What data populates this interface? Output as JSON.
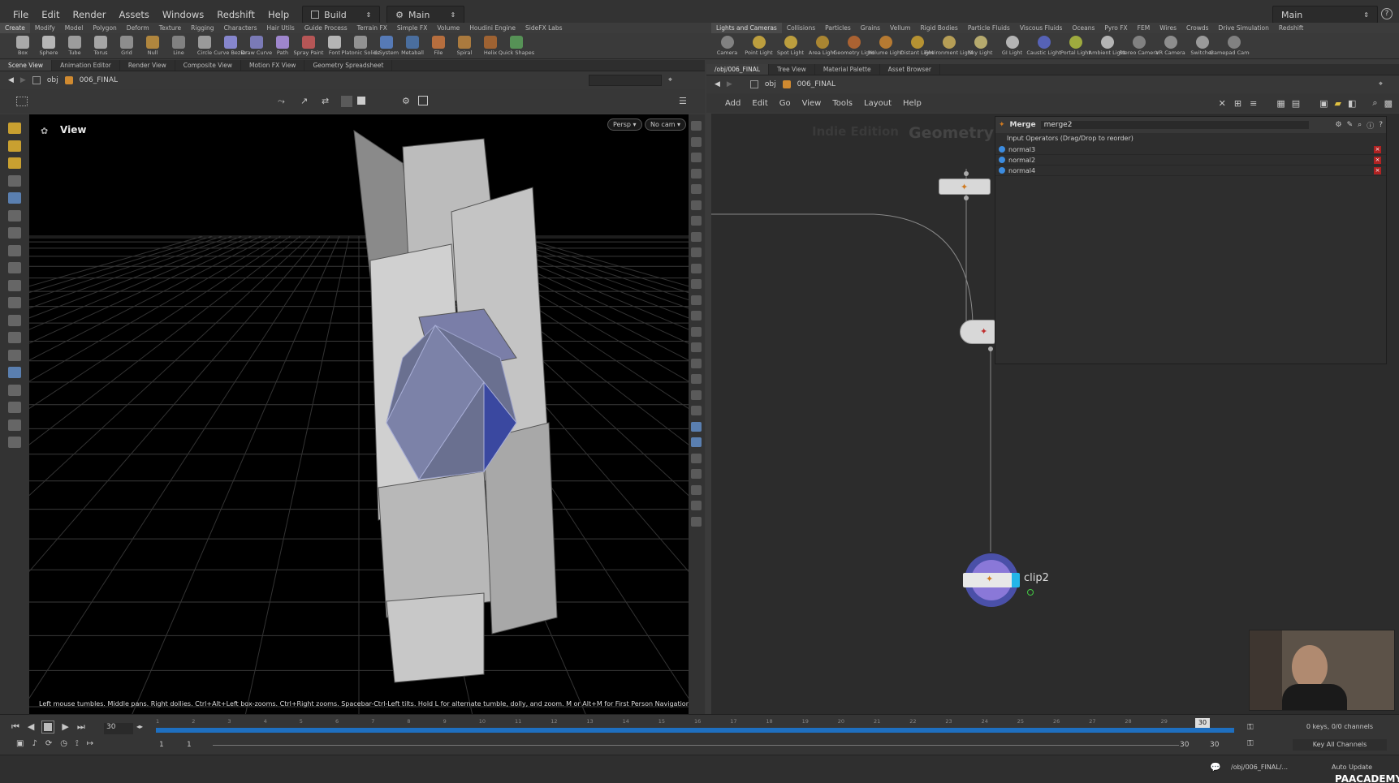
{
  "menu": {
    "items": [
      "File",
      "Edit",
      "Render",
      "Assets",
      "Windows",
      "Redshift",
      "Help"
    ],
    "desktop_left": "Build",
    "desktop_middle": "Main",
    "desktop_right": "Main"
  },
  "shelf_tabs_left": [
    "Create",
    "Modify",
    "Model",
    "Polygon",
    "Deform",
    "Texture",
    "Rigging",
    "Characters",
    "Hair Utils",
    "Guide Process",
    "Terrain FX",
    "Simple FX",
    "Volume",
    "Houdini Engine",
    "SideFX Labs"
  ],
  "shelf_tools_left": [
    "Box",
    "Sphere",
    "Tube",
    "Torus",
    "Grid",
    "Null",
    "Line",
    "Circle",
    "Curve Bezier",
    "Draw Curve",
    "Path",
    "Spray Paint",
    "Font",
    "Platonic Solids",
    "L-System",
    "Metaball",
    "File",
    "Spiral",
    "Helix",
    "Quick Shapes"
  ],
  "shelf_tabs_right": [
    "Lights and Cameras",
    "Collisions",
    "Particles",
    "Grains",
    "Vellum",
    "Rigid Bodies",
    "Particle Fluids",
    "Viscous Fluids",
    "Oceans",
    "Pyro FX",
    "FEM",
    "Wires",
    "Crowds",
    "Drive Simulation",
    "Redshift"
  ],
  "shelf_tools_right": [
    "Camera",
    "Point Light",
    "Spot Light",
    "Area Light",
    "Geometry Light",
    "Volume Light",
    "Distant Light",
    "Environment Light",
    "Sky Light",
    "GI Light",
    "Caustic Light",
    "Portal Light",
    "Ambient Light",
    "Stereo Camera",
    "VR Camera",
    "Switcher",
    "Gamepad Camera"
  ],
  "left_pane": {
    "tabs": [
      "Scene View",
      "Animation Editor",
      "Render View",
      "Composite View",
      "Motion FX View",
      "Geometry Spreadsheet"
    ],
    "path_root": "obj",
    "path_node": "006_FINAL",
    "view_label": "View",
    "persp": "Persp",
    "cam": "No cam",
    "hint": "Left mouse tumbles. Middle pans. Right dollies. Ctrl+Alt+Left box-zooms. Ctrl+Right zooms. Spacebar-Ctrl-Left tilts. Hold L for alternate tumble, dolly, and zoom. M or Alt+M for First Person Navigation."
  },
  "right_pane": {
    "tabs": [
      "/obj/006_FINAL",
      "Tree View",
      "Material Palette",
      "Asset Browser"
    ],
    "path_root": "obj",
    "path_node": "006_FINAL",
    "menu": [
      "Add",
      "Edit",
      "Go",
      "View",
      "Tools",
      "Layout",
      "Help"
    ],
    "watermark_edition": "Indie Edition",
    "watermark_context": "Geometry",
    "node_label": "clip2"
  },
  "params": {
    "type": "Merge",
    "name": "merge2",
    "section": "Input Operators (Drag/Drop to reorder)",
    "inputs": [
      "normal3",
      "normal2",
      "normal4"
    ]
  },
  "timeline": {
    "current_frame": "30",
    "ticks": [
      "1",
      "2",
      "3",
      "4",
      "5",
      "6",
      "7",
      "8",
      "9",
      "10",
      "11",
      "12",
      "13",
      "14",
      "15",
      "16",
      "17",
      "18",
      "19",
      "20",
      "21",
      "22",
      "23",
      "24",
      "25",
      "26",
      "27",
      "28",
      "29",
      "30"
    ],
    "start_a": "1",
    "start_b": "1",
    "end_a": "30",
    "end_b": "30",
    "keys_info": "0 keys, 0/0 channels",
    "key_all": "Key All Channels"
  },
  "status": {
    "path": "/obj/006_FINAL/...",
    "auto_update": "Auto Update",
    "brand": "PAACADEMY"
  },
  "colors": {
    "accent_blue": "#1f7fd0",
    "timeline_blue": "#1e6fc0",
    "node_cyan": "#23b5e8",
    "node_purple": "#6a4fc4"
  }
}
